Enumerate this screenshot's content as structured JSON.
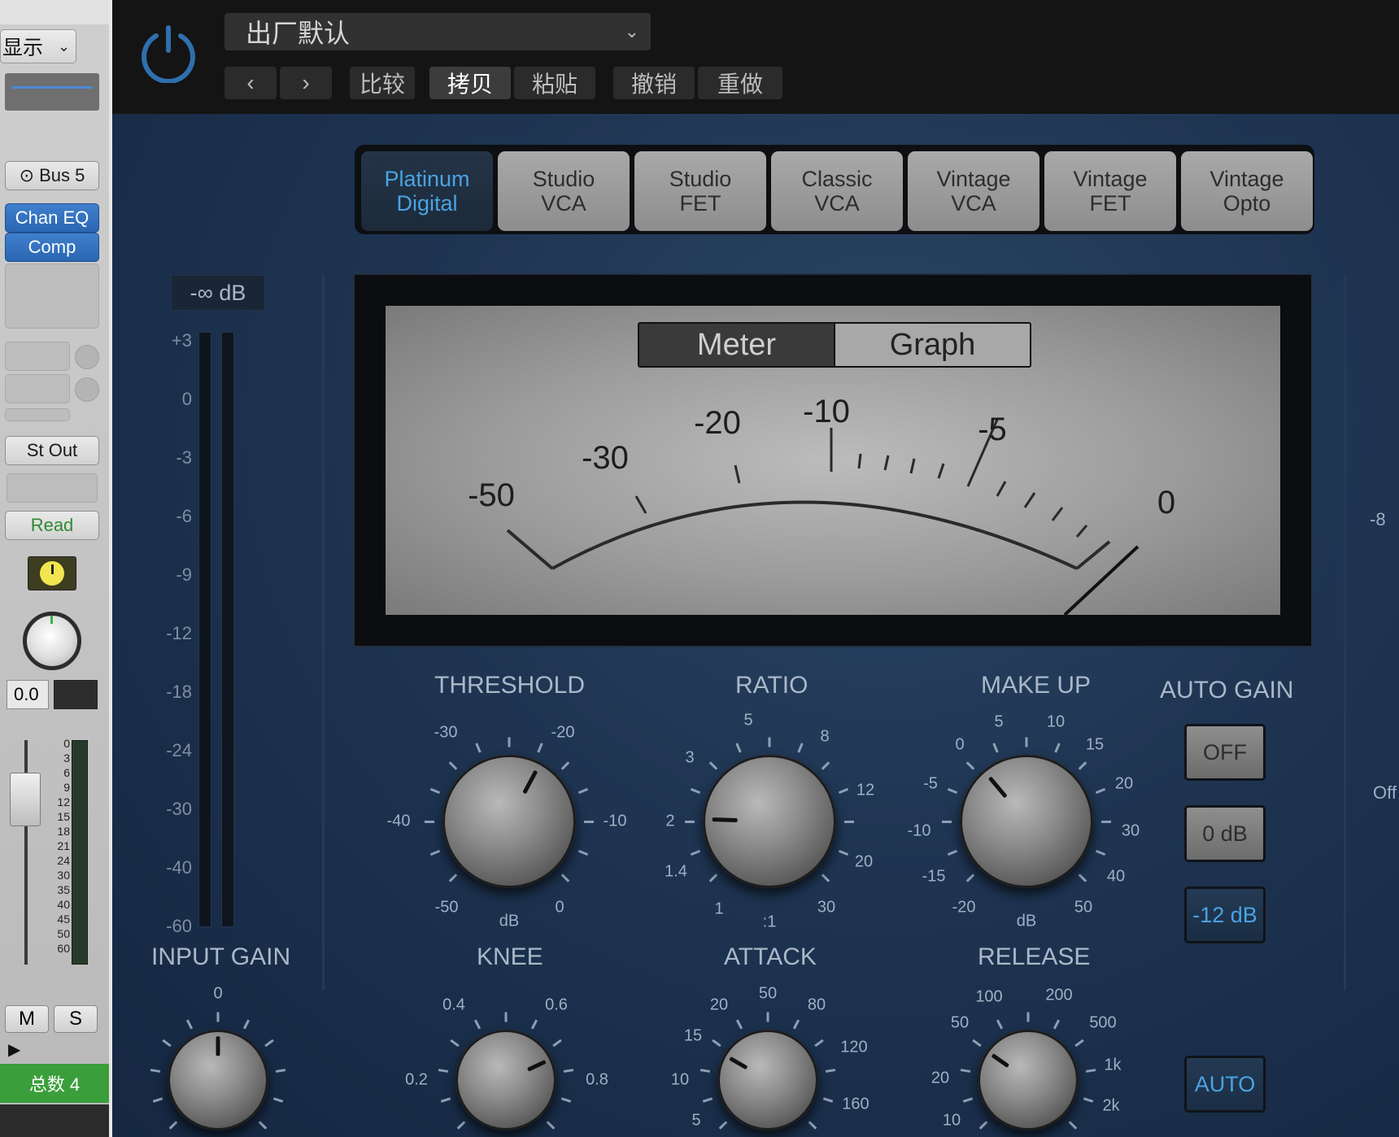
{
  "strip": {
    "display_menu": "显示",
    "bus": "Bus 5",
    "plugins": [
      "Chan EQ",
      "Comp"
    ],
    "output": "St Out",
    "automation": "Read",
    "volume": "0.0",
    "mute": "M",
    "solo": "S",
    "track_label": "总数 4",
    "fader_scale": [
      "0",
      "3",
      "6",
      "9",
      "12",
      "15",
      "18",
      "21",
      "24",
      "30",
      "35",
      "40",
      "45",
      "50",
      "60"
    ]
  },
  "header": {
    "preset": "出厂默认",
    "compare": "比较",
    "copy": "拷贝",
    "paste": "粘贴",
    "undo": "撤销",
    "redo": "重做"
  },
  "models": [
    [
      "Platinum",
      "Digital"
    ],
    [
      "Studio",
      "VCA"
    ],
    [
      "Studio",
      "FET"
    ],
    [
      "Classic",
      "VCA"
    ],
    [
      "Vintage",
      "VCA"
    ],
    [
      "Vintage",
      "FET"
    ],
    [
      "Vintage",
      "Opto"
    ]
  ],
  "active_model": 0,
  "input_meter": {
    "peak": "-∞ dB",
    "scale": [
      "+3",
      "0",
      "-3",
      "-6",
      "-9",
      "-12",
      "-18",
      "-24",
      "-30",
      "-40",
      "-60"
    ]
  },
  "vu": {
    "mode_meter": "Meter",
    "mode_graph": "Graph",
    "labels": [
      "-50",
      "-30",
      "-20",
      "-10",
      "-5",
      "0"
    ]
  },
  "controls": {
    "threshold": {
      "label": "THRESHOLD",
      "unit": "dB",
      "ticks": [
        "-30",
        "-20",
        "-40",
        "-10",
        "-50",
        "0"
      ]
    },
    "ratio": {
      "label": "RATIO",
      "unit": ":1",
      "ticks": [
        "5",
        "3",
        "8",
        "12",
        "2",
        "20",
        "1.4",
        "1",
        "30"
      ]
    },
    "makeup": {
      "label": "MAKE UP",
      "unit": "dB",
      "ticks": [
        "5",
        "10",
        "0",
        "15",
        "-5",
        "20",
        "-10",
        "30",
        "-15",
        "40",
        "-20",
        "50"
      ]
    },
    "input_gain": {
      "label": "INPUT GAIN",
      "ticks": [
        "0"
      ]
    },
    "knee": {
      "label": "KNEE",
      "ticks": [
        "0.4",
        "0.6",
        "0.2",
        "0.8"
      ]
    },
    "attack": {
      "label": "ATTACK",
      "ticks": [
        "50",
        "20",
        "80",
        "15",
        "120",
        "10",
        "160",
        "5"
      ]
    },
    "release": {
      "label": "RELEASE",
      "ticks": [
        "100",
        "200",
        "50",
        "500",
        "20",
        "1k",
        "10",
        "2k"
      ]
    }
  },
  "auto_gain": {
    "label": "AUTO GAIN",
    "options": [
      "OFF",
      "0 dB",
      "-12 dB"
    ],
    "active": "-12 dB",
    "auto": "AUTO"
  },
  "right_edge": {
    "value": "-8",
    "off": "Off"
  }
}
